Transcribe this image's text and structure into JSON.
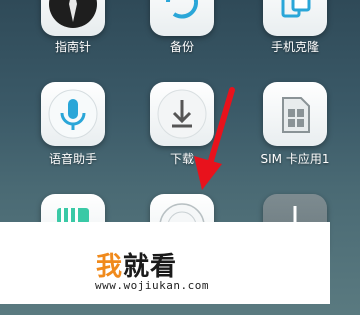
{
  "apps": [
    {
      "label": "指南针",
      "icon": "compass-icon"
    },
    {
      "label": "备份",
      "icon": "backup-icon"
    },
    {
      "label": "手机克隆",
      "icon": "phone-clone-icon"
    },
    {
      "label": "语音助手",
      "icon": "microphone-icon"
    },
    {
      "label": "下载",
      "icon": "download-icon"
    },
    {
      "label": "SIM 卡应用1",
      "icon": "sim-card-icon"
    },
    {
      "label": "",
      "icon": "battery-icon"
    },
    {
      "label": "",
      "icon": "settings-icon"
    },
    {
      "label": "",
      "icon": "add-icon"
    }
  ],
  "watermark": {
    "logo_orange": "我",
    "logo_dark": "就看",
    "url": "www.wojiukan.com"
  },
  "colors": {
    "accent_blue": "#2aa6d8",
    "pointer_red": "#e8121c",
    "logo_orange": "#f08a1c"
  }
}
